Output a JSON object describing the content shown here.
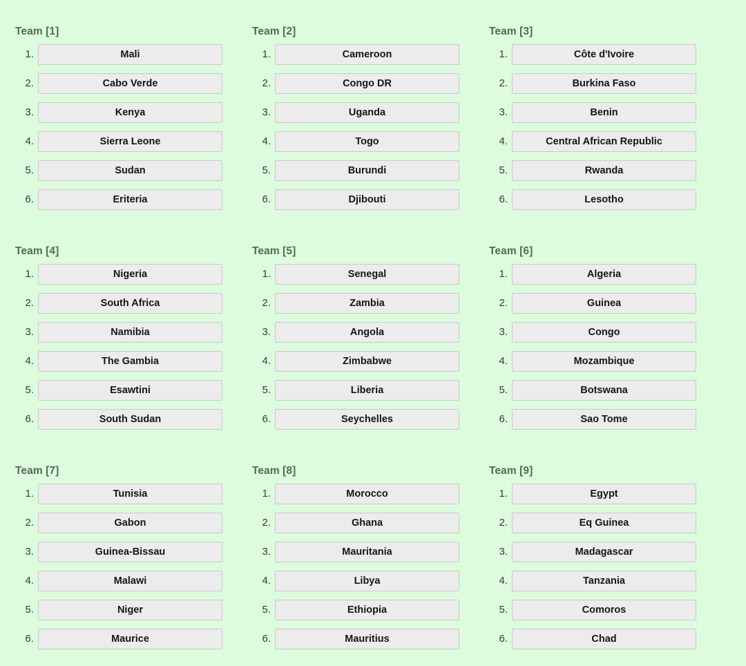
{
  "page": {
    "background_color": "#ddfbdd",
    "slot_background_color": "#ececec",
    "slot_border_color": "#c9c9c9",
    "heading_color": "#536a53",
    "index_color": "#3a3a3a",
    "slot_text_color": "#151515"
  },
  "slot_indices": [
    "1.",
    "2.",
    "3.",
    "4.",
    "5.",
    "6."
  ],
  "teams": [
    {
      "heading": "Team [1]",
      "members": [
        "Mali",
        "Cabo Verde",
        "Kenya",
        "Sierra Leone",
        "Sudan",
        "Eriteria"
      ]
    },
    {
      "heading": "Team [2]",
      "members": [
        "Cameroon",
        "Congo DR",
        "Uganda",
        "Togo",
        "Burundi",
        "Djibouti"
      ]
    },
    {
      "heading": "Team [3]",
      "members": [
        "Côte d'Ivoire",
        "Burkina Faso",
        "Benin",
        "Central African Republic",
        "Rwanda",
        "Lesotho"
      ]
    },
    {
      "heading": "Team [4]",
      "members": [
        "Nigeria",
        "South Africa",
        "Namibia",
        "The Gambia",
        "Esawtini",
        "South Sudan"
      ]
    },
    {
      "heading": "Team [5]",
      "members": [
        "Senegal",
        "Zambia",
        "Angola",
        "Zimbabwe",
        "Liberia",
        "Seychelles"
      ]
    },
    {
      "heading": "Team [6]",
      "members": [
        "Algeria",
        "Guinea",
        "Congo",
        "Mozambique",
        "Botswana",
        "Sao Tome"
      ]
    },
    {
      "heading": "Team [7]",
      "members": [
        "Tunisia",
        "Gabon",
        "Guinea-Bissau",
        "Malawi",
        "Niger",
        "Maurice"
      ]
    },
    {
      "heading": "Team [8]",
      "members": [
        "Morocco",
        "Ghana",
        "Mauritania",
        "Libya",
        "Ethiopia",
        "Mauritius"
      ]
    },
    {
      "heading": "Team [9]",
      "members": [
        "Egypt",
        "Eq Guinea",
        "Madagascar",
        "Tanzania",
        "Comoros",
        "Chad"
      ]
    }
  ]
}
